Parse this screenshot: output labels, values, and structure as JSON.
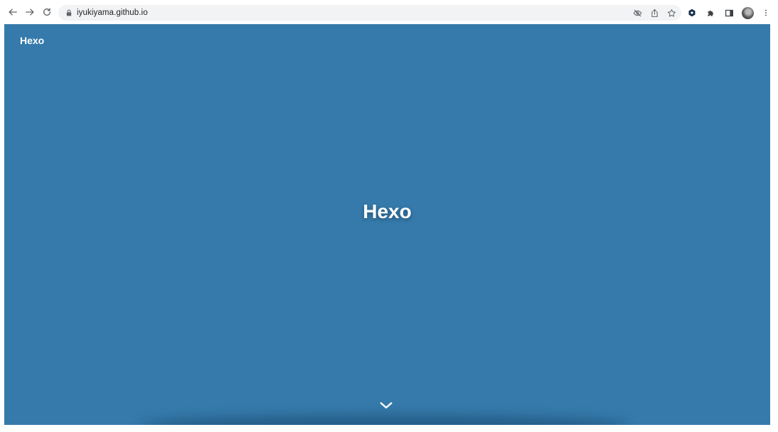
{
  "browser": {
    "url": "iyukiyama.github.io",
    "nav_icons": [
      "back-arrow-icon",
      "forward-arrow-icon",
      "reload-icon"
    ],
    "omnibox_icons": [
      "eye-off-icon",
      "share-icon",
      "star-icon"
    ],
    "toolbar_icons": [
      "extension-hexagon-icon",
      "puzzle-icon",
      "side-panel-icon",
      "profile-avatar",
      "kebab-menu-icon"
    ]
  },
  "site": {
    "brand": "Hexo",
    "hero_title": "Hexo",
    "background_color": "#357aab",
    "scroll_icon": "chevron-down-icon"
  }
}
